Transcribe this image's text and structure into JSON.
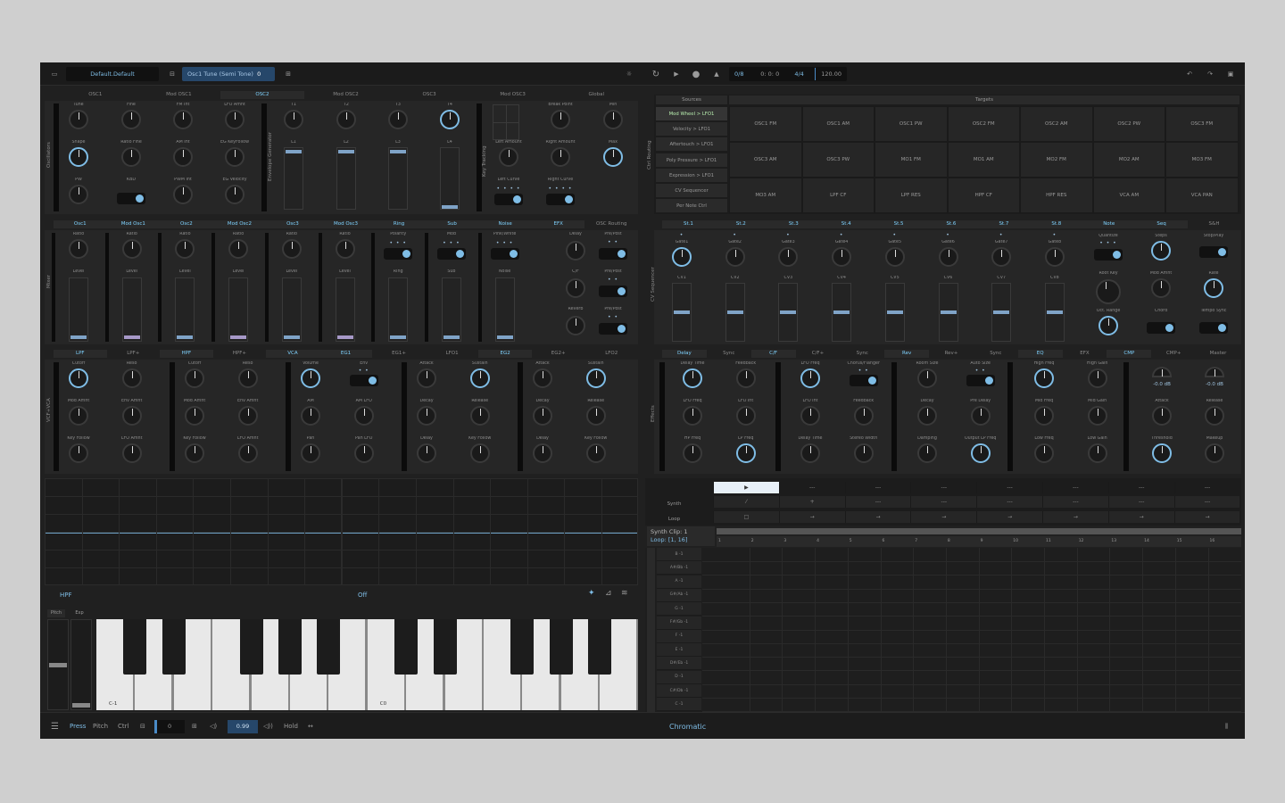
{
  "toolbar": {
    "preset_name": "Default.Default",
    "param_label": "Osc1 Tune (Semi Tone)",
    "param_value": "0",
    "counter": "0/8",
    "position": "0: 0: 0",
    "time_sig": "4/4",
    "tempo": "120.00"
  },
  "osc_tabs": [
    "OSC1",
    "Mod OSC1",
    "OSC2",
    "Mod OSC2",
    "OSC3",
    "Mod OSC3",
    "Global"
  ],
  "sections": {
    "oscillators": "Oscillators",
    "envelope": "Envelope Generator",
    "keytracking": "Key Tracking",
    "ctrl_routing": "Ctrl Routing",
    "mixer": "Mixer",
    "cv_sequencer": "CV Sequencer",
    "vcf_vca": "VCF+VCA",
    "effects": "Effects"
  },
  "osc": {
    "tune": "Tune",
    "fine": "Fine",
    "fm_int": "FM Int",
    "lfo_amnt": "LFO Amnt",
    "shape": "Shape",
    "ratio_fine": "Ratio Fine",
    "am_int": "AM Int",
    "eg_keyfollow": "EG KeyFollow",
    "pw": "PW",
    "kbd": "KBD",
    "pwm_int": "PWM Int",
    "eg_velocity": "EG Velocity"
  },
  "envgen": {
    "top": [
      "T1",
      "T2",
      "T3",
      "T4"
    ],
    "mid": [
      "L1",
      "L2",
      "L3",
      "L4"
    ]
  },
  "keytrack": {
    "break_point": "Break Point",
    "min": "Min",
    "left_amount": "Left Amount",
    "right_amount": "Right Amount",
    "max": "Max",
    "left_curve": "Left Curve",
    "right_curve": "Right Curve"
  },
  "routing": {
    "sources_header": "Sources",
    "targets_header": "Targets",
    "sources": [
      "Mod Wheel > LFO1",
      "Velocity > LFO1",
      "Aftertouch > LFO1",
      "Poly Pressure > LFO1",
      "Expression > LFO1",
      "CV Sequencer",
      "Per Note Ctrl"
    ],
    "targets": [
      "OSC1 FM",
      "OSC1 AM",
      "OSC1 PW",
      "OSC2 FM",
      "OSC2 AM",
      "OSC2 PW",
      "OSC3 FM",
      "OSC3 AM",
      "OSC3 PW",
      "MO1 FM",
      "MO1 AM",
      "MO2 FM",
      "MO2 AM",
      "MO3 FM",
      "MO3 AM",
      "LPF CF",
      "LPF RES",
      "HPF CF",
      "HPF RES",
      "VCA AM",
      "VCA PAN"
    ]
  },
  "mixer": {
    "tabs": [
      "Osc1",
      "Mod Osc1",
      "Osc2",
      "Mod Osc2",
      "Osc3",
      "Mod Osc3",
      "Ring",
      "Sub",
      "Noise",
      "EFX",
      "OSC Routing"
    ],
    "top_labels": [
      "Ratio",
      "Ratio",
      "Ratio",
      "Ratio",
      "Ratio",
      "Ratio",
      "Polarity",
      "Mod",
      "Pink/White"
    ],
    "bottom_labels": [
      "Level",
      "Level",
      "Level",
      "Level",
      "Level",
      "Level",
      "Ring",
      "Sub",
      "Noise"
    ],
    "efx": [
      "Delay",
      "C/F",
      "Reverb"
    ],
    "prepost": "Pre/Post"
  },
  "seq": {
    "tabs": [
      "St.1",
      "St.2",
      "St.3",
      "St.4",
      "St.5",
      "St.6",
      "St.7",
      "St.8",
      "Note",
      "Seq",
      "S&H"
    ],
    "gates": [
      "Gate1",
      "Gate2",
      "Gate3",
      "Gate4",
      "Gate5",
      "Gate6",
      "Gate7",
      "Gate8"
    ],
    "cvs": [
      "CV1",
      "CV2",
      "CV3",
      "CV4",
      "CV5",
      "CV6",
      "CV7",
      "CV8"
    ],
    "note": {
      "quantize": "Quantize",
      "root_key": "Root Key",
      "oct_range": "Oct. Range"
    },
    "seqp": {
      "steps": "Steps",
      "mod_amnt": "Mod Amnt",
      "chord": "Chord"
    },
    "sh": {
      "stop_play": "Stop/Play",
      "rate": "Rate",
      "tempo_sync": "Tempo Sync"
    }
  },
  "filt": {
    "tabs": [
      "LPF",
      "LPF+",
      "HPF",
      "HPF+",
      "VCA",
      "EG1",
      "EG1+",
      "LFO1",
      "EG2",
      "EG2+",
      "LFO2"
    ],
    "lpf": [
      "Cutoff",
      "Reso",
      "Mod Amnt",
      "Env Amnt",
      "Key Follow",
      "LFO Amnt"
    ],
    "hpf": [
      "Cutoff",
      "Reso",
      "Mod Amnt",
      "Env Amnt",
      "Key Follow",
      "LFO Amnt"
    ],
    "vca": [
      "Volume",
      "Env",
      "AM",
      "AM LFO",
      "Pan",
      "Pan LFO"
    ],
    "eg1": [
      "Attack",
      "Sustain",
      "Decay",
      "Release",
      "Delay",
      "Key Follow"
    ],
    "eg2": [
      "Attack",
      "Sustain",
      "Decay",
      "Release",
      "Delay",
      "Key Follow"
    ]
  },
  "fx": {
    "tabs": [
      "Delay",
      "Sync",
      "C/F",
      "C/F+",
      "Sync",
      "Rev",
      "Rev+",
      "Sync",
      "EQ",
      "EFX",
      "CMP",
      "CMP+",
      "Master"
    ],
    "delay": [
      "Delay Time",
      "Feedback",
      "LFO Freq",
      "LFO Int",
      "HP Freq",
      "LP Freq"
    ],
    "cf": [
      "LFO Freq",
      "Chorus/Flanger",
      "LFO Int",
      "Feedback",
      "Delay Time",
      "Stereo Width"
    ],
    "rev": [
      "Room Size",
      "Auto Size",
      "Decay",
      "Pre Delay",
      "Damping",
      "Output LP Freq"
    ],
    "eq": [
      "High Freq",
      "High Gain",
      "Mid Freq",
      "Mid Gain",
      "Low Freq",
      "Low Gain"
    ],
    "cmp": [
      "Attack",
      "Release",
      "Threshold",
      "Makeup"
    ],
    "meters": [
      "-0.0 dB",
      "-0.0 dB"
    ]
  },
  "scope": {
    "filter": "HPF",
    "mode": "Off"
  },
  "kbd": {
    "tabs": [
      "Pitch",
      "Exp"
    ],
    "c_minus1": "C-1",
    "c0": "C0"
  },
  "patterns": {
    "row_synth": "Synth",
    "row_loop": "Loop",
    "dashes": "---",
    "clip": "Synth Clip: 1",
    "loop": "Loop: [1, 16]",
    "ruler": [
      "1",
      "2",
      "3",
      "4",
      "5",
      "6",
      "7",
      "8",
      "9",
      "10",
      "11",
      "12",
      "13",
      "14",
      "15",
      "16"
    ],
    "notes": [
      "B -1",
      "A#/Bb -1",
      "A -1",
      "G#/Ab -1",
      "G -1",
      "F#/Gb -1",
      "F -1",
      "E -1",
      "D#/Eb -1",
      "D -1",
      "C#/Db -1",
      "C -1"
    ]
  },
  "bottom": {
    "press": "Press",
    "pitch": "Pitch",
    "ctrl": "Ctrl",
    "octave": "0",
    "velocity": "0.99",
    "hold": "Hold",
    "scale": "Chromatic"
  }
}
